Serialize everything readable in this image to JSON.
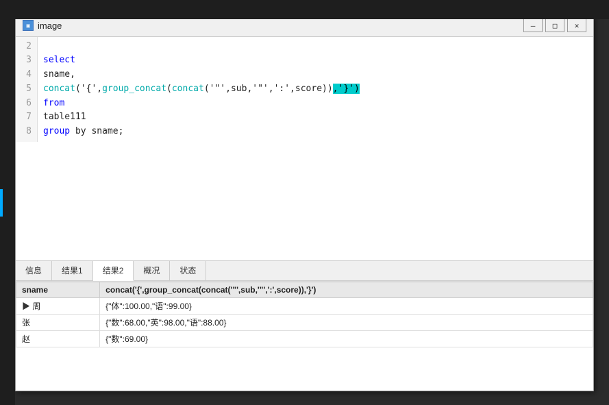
{
  "window": {
    "title": "image",
    "icon_label": "img",
    "controls": {
      "minimize": "—",
      "maximize": "□",
      "close": "✕"
    }
  },
  "editor": {
    "lines": [
      {
        "num": "2",
        "content": "",
        "tokens": []
      },
      {
        "num": "3",
        "content": "select",
        "tokens": [
          {
            "text": "select",
            "type": "kw"
          }
        ]
      },
      {
        "num": "4",
        "content": "sname,",
        "tokens": [
          {
            "text": "sname,",
            "type": "plain"
          }
        ]
      },
      {
        "num": "5",
        "content": "concat('{',group_concat(concat('\"',sub,'\"',':',score)),'}');",
        "tokens": [
          {
            "text": "concat",
            "type": "fn"
          },
          {
            "text": "('{',",
            "type": "plain"
          },
          {
            "text": "group_concat",
            "type": "fn"
          },
          {
            "text": "(",
            "type": "plain"
          },
          {
            "text": "concat",
            "type": "fn"
          },
          {
            "text": "('\"',sub,'\"',':',score))",
            "type": "plain"
          },
          {
            "text": ",'}')",
            "type": "highlight-bg"
          }
        ]
      },
      {
        "num": "6",
        "content": "from",
        "tokens": [
          {
            "text": "from",
            "type": "kw"
          }
        ]
      },
      {
        "num": "7",
        "content": "table111",
        "tokens": [
          {
            "text": "table111",
            "type": "plain"
          }
        ]
      },
      {
        "num": "8",
        "content": "group by sname;",
        "tokens": [
          {
            "text": "group",
            "type": "kw"
          },
          {
            "text": " by sname;",
            "type": "plain"
          }
        ]
      }
    ]
  },
  "tabs": [
    {
      "label": "信息",
      "active": false
    },
    {
      "label": "结果1",
      "active": false
    },
    {
      "label": "结果2",
      "active": true
    },
    {
      "label": "概况",
      "active": false
    },
    {
      "label": "状态",
      "active": false
    }
  ],
  "table": {
    "headers": [
      "sname",
      "concat('{',group_concat(concat('\"',sub,'\"',':',score)),'}')"
    ],
    "rows": [
      {
        "sname": "周",
        "value": "{\"体\":100.00,\"语\":99.00}",
        "first": true
      },
      {
        "sname": "张",
        "value": "{\"数\":68.00,\"英\":98.00,\"语\":88.00}",
        "first": false
      },
      {
        "sname": "赵",
        "value": "{\"数\":69.00}",
        "first": false
      }
    ]
  }
}
